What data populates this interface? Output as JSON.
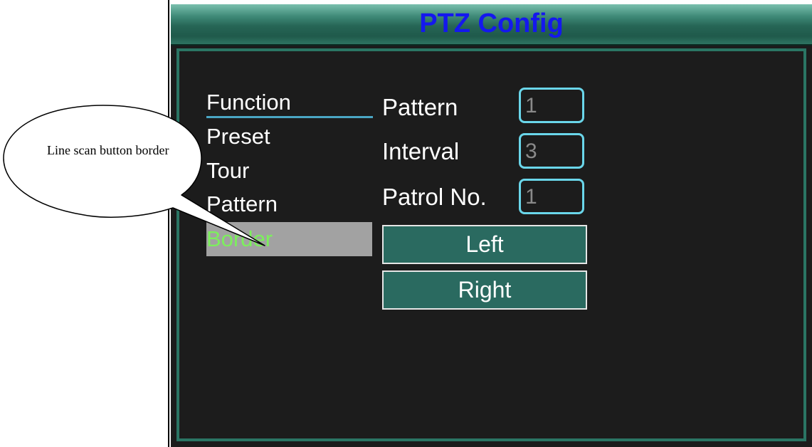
{
  "window": {
    "title": "PTZ Config"
  },
  "menu": {
    "items": [
      {
        "label": "Function"
      },
      {
        "label": "Preset"
      },
      {
        "label": "Tour"
      },
      {
        "label": "Pattern"
      },
      {
        "label": "Border",
        "selected": true
      }
    ]
  },
  "fields": [
    {
      "label": "Pattern",
      "value": "1"
    },
    {
      "label": "Interval",
      "value": "3"
    },
    {
      "label": "Patrol No.",
      "value": "1"
    }
  ],
  "buttons": {
    "left_label": "Left",
    "right_label": "Right"
  },
  "callout": {
    "text": "Line scan button border"
  },
  "colors": {
    "title_text": "#1418ee",
    "titlebar": "#266555",
    "background": "#1c1c1c",
    "field_border": "#6ad6ea",
    "selected_bg": "#a2a2a2",
    "selected_text": "#7cf05c",
    "button_bg": "#2a6a60"
  }
}
